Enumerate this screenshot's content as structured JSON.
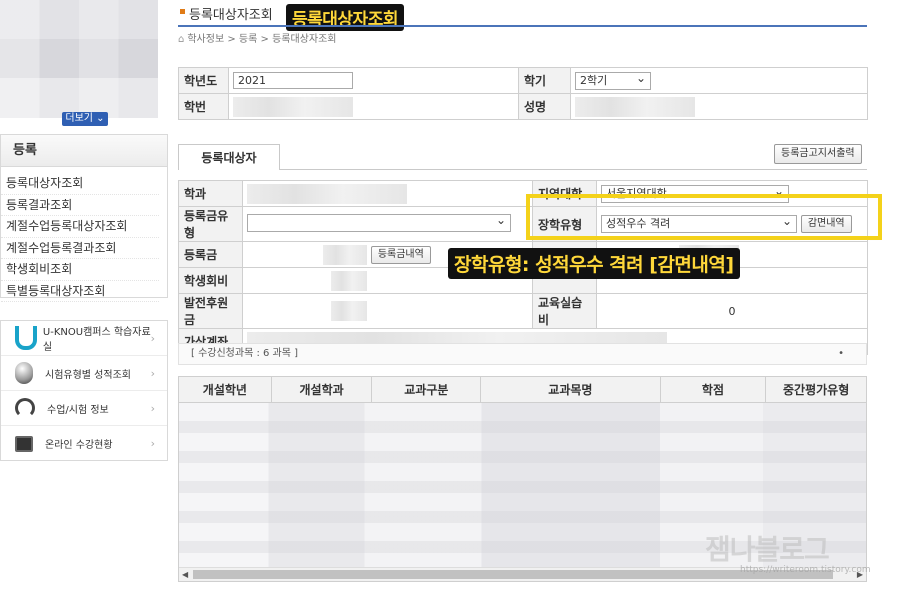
{
  "sidebar": {
    "more_label": "더보기 ⌄",
    "menu_title": "등록",
    "menu_items": [
      "등록대상자조회",
      "등록결과조회",
      "계절수업등록대상자조회",
      "계절수업등록결과조회",
      "학생회비조회",
      "특별등록대상자조회"
    ],
    "links": [
      {
        "label": "U-KNOU캠퍼스 학습자료실",
        "icon": "u-knou-icon"
      },
      {
        "label": "시험유형별 성적조회",
        "icon": "mouse-icon"
      },
      {
        "label": "수업/시험 정보",
        "icon": "headset-icon"
      },
      {
        "label": "온라인 수강현황",
        "icon": "monitor-icon"
      }
    ]
  },
  "header": {
    "title": "등록대상자조회",
    "callout": "등록대상자조회",
    "breadcrumb": [
      "학사정보",
      "등록",
      "등록대상자조회"
    ]
  },
  "student": {
    "year_label": "학년도",
    "year_value": "2021",
    "semester_label": "학기",
    "semester_value": "2학기",
    "id_label": "학번",
    "name_label": "성명"
  },
  "tab": {
    "label": "등록대상자",
    "print_label": "등록금고지서출력"
  },
  "registration": {
    "dept_label": "학과",
    "region_label": "지역대학",
    "region_value": "서울지역대학",
    "fee_type_label": "등록금유형",
    "scholarship_label": "장학유형",
    "scholarship_value": "성적우수 격려",
    "reduction_button": "감면내역",
    "fee_label": "등록금",
    "fee_detail_button": "등록금내역",
    "council_label": "학생회비",
    "dev_fund_label": "발전후원금",
    "practice_label": "교육실습비",
    "practice_value": "0",
    "virtual_account_label": "가상계좌"
  },
  "annotation": {
    "text": "장학유형: 성적우수 격려 [감면내역]",
    "color": "#f4d21a"
  },
  "courses": {
    "count_text": "[ 수강신청과목 : 6 과목 ]",
    "dot": "•",
    "columns": [
      "개설학년",
      "개설학과",
      "교과구분",
      "교과목명",
      "학점",
      "중간평가유형"
    ]
  },
  "watermark": {
    "text": "잼나블로그",
    "url": "https://writeroom.tistory.com"
  }
}
